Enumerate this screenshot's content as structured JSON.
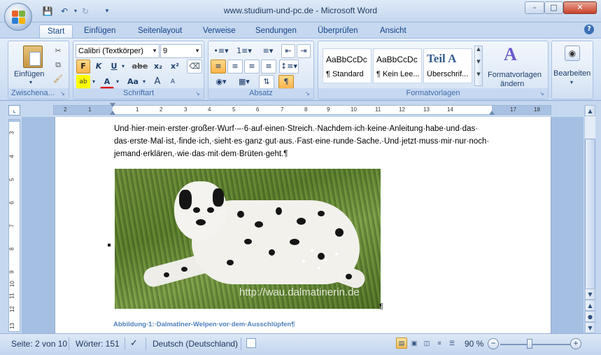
{
  "window": {
    "title": "www.studium-und-pc.de - Microsoft Word",
    "minimize": "–",
    "maximize": "□",
    "close": "✕"
  },
  "quick_access": {
    "save_icon": "floppy-disk-icon",
    "undo_icon": "undo-icon",
    "redo_icon": "redo-icon",
    "customize_icon": "dropdown-icon"
  },
  "tabs": [
    {
      "label": "Start",
      "active": true
    },
    {
      "label": "Einfügen"
    },
    {
      "label": "Seitenlayout"
    },
    {
      "label": "Verweise"
    },
    {
      "label": "Sendungen"
    },
    {
      "label": "Überprüfen"
    },
    {
      "label": "Ansicht"
    }
  ],
  "ribbon": {
    "clipboard": {
      "label": "Zwischena...",
      "paste_label": "Einfügen"
    },
    "font": {
      "label": "Schriftart",
      "font_name": "Calibri (Textkörper)",
      "font_size": "9",
      "bold": "F",
      "italic": "K",
      "underline": "U",
      "strike": "abe",
      "subscript": "x₂",
      "superscript": "x²",
      "change_case": "Aa",
      "grow": "A",
      "shrink": "A"
    },
    "paragraph": {
      "label": "Absatz",
      "pilcrow": "¶"
    },
    "styles": {
      "label": "Formatvorlagen",
      "items": [
        {
          "sample": "AaBbCcDc",
          "name": "¶ Standard"
        },
        {
          "sample": "AaBbCcDc",
          "name": "¶ Kein Lee..."
        },
        {
          "sample": "Teil A",
          "name": "Überschrif..."
        }
      ],
      "change_styles": "Formatvorlagen",
      "change_styles_2": "ändern"
    },
    "editing": {
      "label": "Bearbeiten"
    }
  },
  "ruler": {
    "h_ticks": [
      "2",
      "1",
      "1",
      "2",
      "3",
      "4",
      "5",
      "6",
      "7",
      "8",
      "9",
      "10",
      "11",
      "12",
      "13",
      "14",
      "15",
      "17",
      "18"
    ],
    "v_ticks": [
      "3",
      "4",
      "5",
      "6",
      "7",
      "8",
      "9",
      "10",
      "11",
      "12",
      "13"
    ]
  },
  "document": {
    "lines": [
      "Und·hier·mein·erster·großer·Wurf·–·6·auf·einen·Streich.·Nachdem·ich·keine·Anleitung·habe·und·das·",
      "das·erste·Mal·ist,·finde·ich,·sieht·es·ganz·gut·aus.·Fast·eine·runde·Sache.·Und·jetzt·muss·mir·nur·noch·",
      "jemand·erklären,·wie·das·mit·dem·Brüten·geht.¶"
    ],
    "image_watermark": "http://wau.dalmatinerin.de",
    "image_pilcrow": "¶",
    "caption": "Abbildung·1:·Dalmatiner-Welpen·vor·dem·Ausschlüpfen¶"
  },
  "status": {
    "page": "Seite: 2 von 10",
    "words": "Wörter: 151",
    "language": "Deutsch (Deutschland)",
    "zoom": "90 %",
    "zoom_minus": "−",
    "zoom_plus": "+"
  }
}
